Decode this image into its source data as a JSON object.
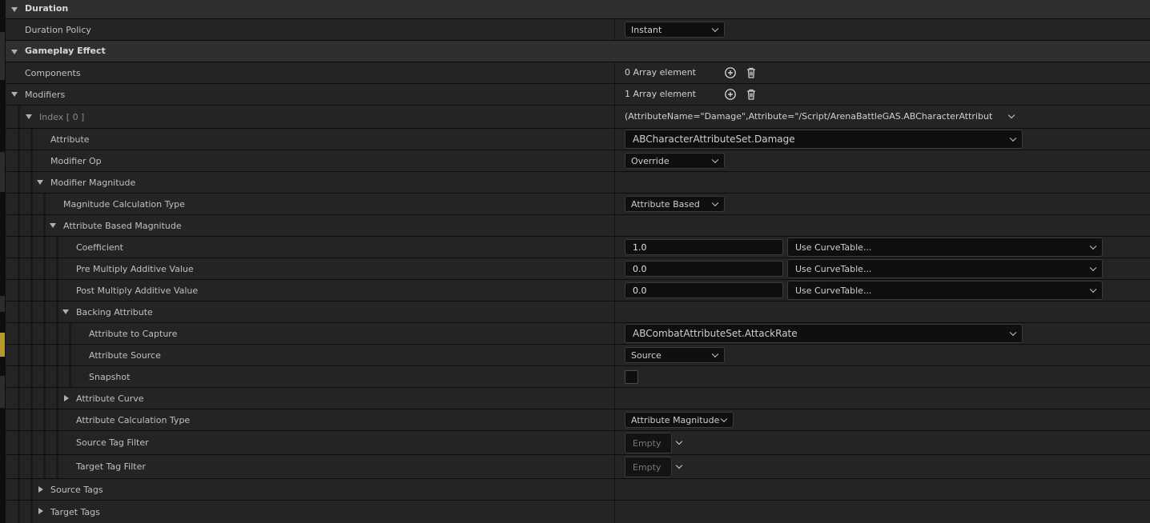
{
  "categories": {
    "duration": "Duration",
    "gameplay_effect": "Gameplay Effect"
  },
  "props": {
    "duration_policy": {
      "label": "Duration Policy",
      "value": "Instant"
    },
    "components": {
      "label": "Components",
      "value": "0 Array element"
    },
    "modifiers": {
      "label": "Modifiers",
      "value": "1 Array element"
    },
    "index0": {
      "label": "Index [ 0 ]",
      "value": "(AttributeName=\"Damage\",Attribute=\"/Script/ArenaBattleGAS.ABCharacterAttributeSet:Dam"
    },
    "attribute": {
      "label": "Attribute",
      "value": "ABCharacterAttributeSet.Damage"
    },
    "modifier_op": {
      "label": "Modifier Op",
      "value": "Override"
    },
    "modifier_magnitude": {
      "label": "Modifier Magnitude"
    },
    "magnitude_calc_type": {
      "label": "Magnitude Calculation Type",
      "value": "Attribute Based"
    },
    "attribute_based_magnitude": {
      "label": "Attribute Based Magnitude"
    },
    "coefficient": {
      "label": "Coefficient",
      "value": "1.0",
      "curve": "Use CurveTable..."
    },
    "pre_multiply": {
      "label": "Pre Multiply Additive Value",
      "value": "0.0",
      "curve": "Use CurveTable..."
    },
    "post_multiply": {
      "label": "Post Multiply Additive Value",
      "value": "0.0",
      "curve": "Use CurveTable..."
    },
    "backing_attribute": {
      "label": "Backing Attribute"
    },
    "attribute_to_capture": {
      "label": "Attribute to Capture",
      "value": "ABCombatAttributeSet.AttackRate"
    },
    "attribute_source": {
      "label": "Attribute Source",
      "value": "Source"
    },
    "snapshot": {
      "label": "Snapshot",
      "checked": false
    },
    "attribute_curve": {
      "label": "Attribute Curve"
    },
    "attribute_calc_type": {
      "label": "Attribute Calculation Type",
      "value": "Attribute Magnitude"
    },
    "source_tag_filter": {
      "label": "Source Tag Filter",
      "value": "Empty"
    },
    "target_tag_filter": {
      "label": "Target Tag Filter",
      "value": "Empty"
    },
    "source_tags": {
      "label": "Source Tags"
    },
    "target_tags": {
      "label": "Target Tags"
    }
  },
  "icons": {
    "add": "plus-circle-icon",
    "delete": "trash-icon"
  },
  "colors": {
    "panel": "#242424",
    "category": "#2f2f2f",
    "input": "#0f0f0f",
    "text": "#c0c0c0"
  }
}
